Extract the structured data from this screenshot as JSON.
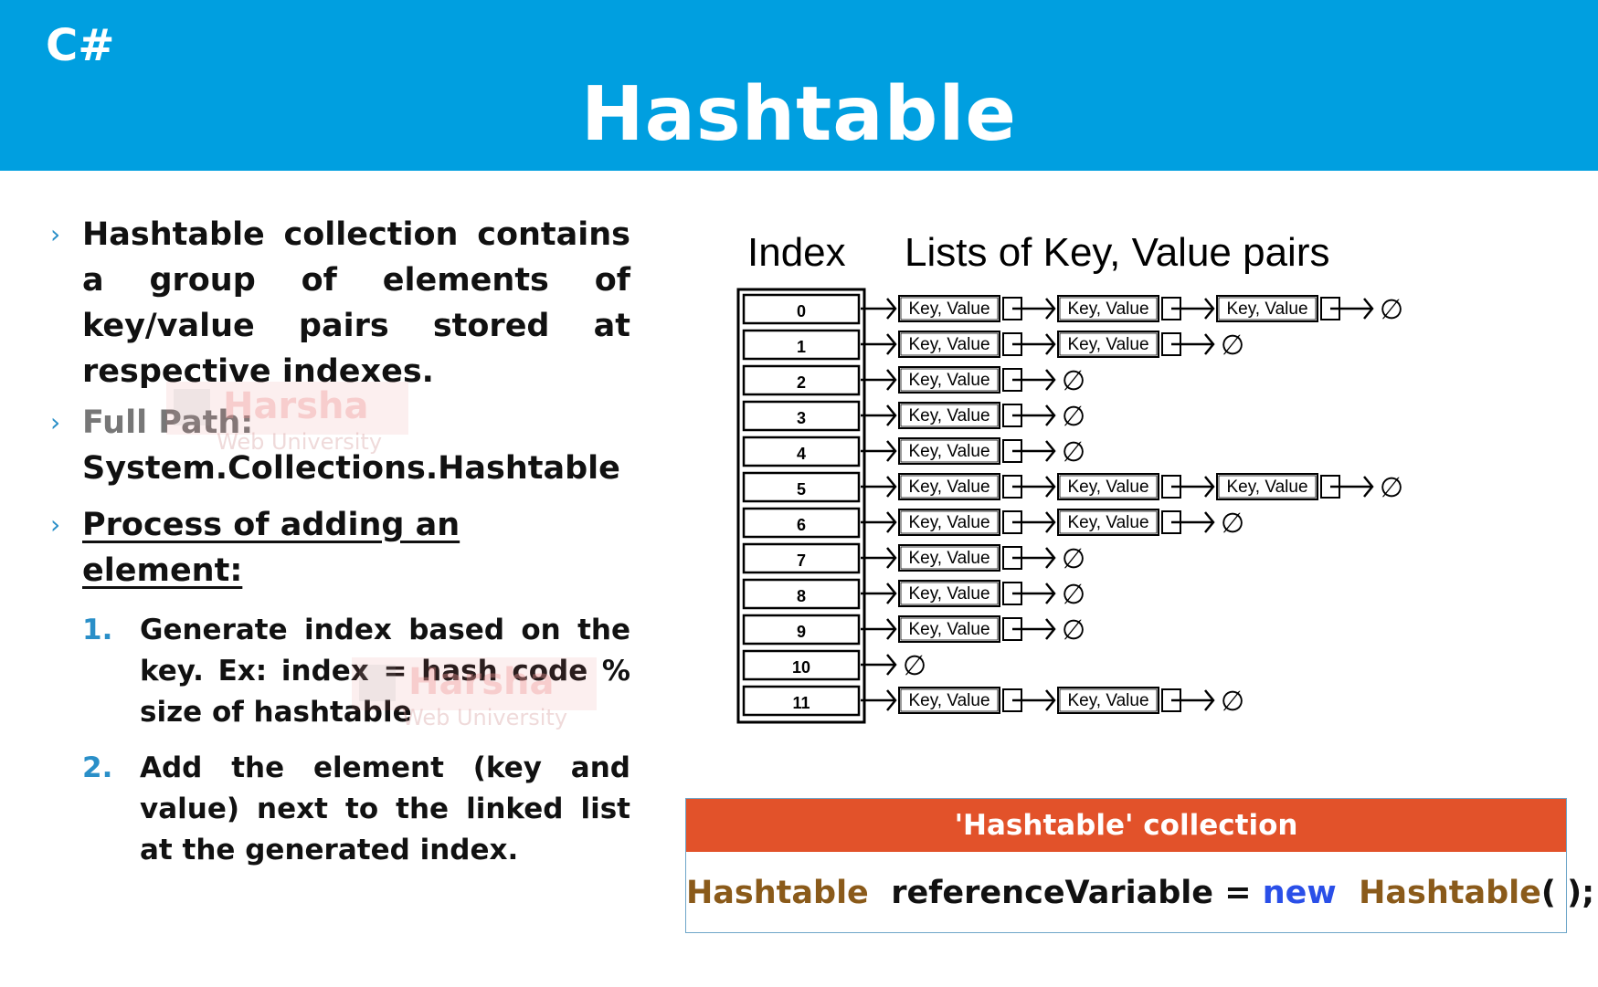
{
  "header": {
    "brand": "C#",
    "title": "Hashtable"
  },
  "content": {
    "bullet1": "Hashtable collection contains a group of elements of key/value pairs stored at respective indexes.",
    "bullet2_label": "Full Path:",
    "bullet2_value": "System.Collections.Hashtable",
    "bullet3_label": "Process of adding an element:",
    "steps": [
      {
        "num": "1.",
        "text": "Generate index based on the key. Ex: index = hash code % size of hashtable"
      },
      {
        "num": "2.",
        "text": "Add the element (key and value) next to the linked list at the generated index."
      }
    ]
  },
  "watermark": {
    "name": "Harsha",
    "sub": "Web University"
  },
  "diagram": {
    "index_heading": "Index",
    "lists_heading": "Lists of Key, Value pairs",
    "entry_label": "Key, Value",
    "null_symbol": "∅",
    "rows": [
      {
        "index": "0",
        "entries": 3
      },
      {
        "index": "1",
        "entries": 2
      },
      {
        "index": "2",
        "entries": 1
      },
      {
        "index": "3",
        "entries": 1
      },
      {
        "index": "4",
        "entries": 1
      },
      {
        "index": "5",
        "entries": 3
      },
      {
        "index": "6",
        "entries": 2
      },
      {
        "index": "7",
        "entries": 1
      },
      {
        "index": "8",
        "entries": 1
      },
      {
        "index": "9",
        "entries": 1
      },
      {
        "index": "10",
        "entries": 0
      },
      {
        "index": "11",
        "entries": 2
      }
    ]
  },
  "code": {
    "heading": "'Hashtable' collection",
    "type_name": "Hashtable",
    "variable": "referenceVariable",
    "equals": "=",
    "keyword": "new",
    "ctor_name": "Hashtable",
    "parens": "( );",
    "colors": {
      "type": "#8a5a1a",
      "keyword": "#2a4fe8",
      "header_bg": "#e2522a"
    }
  },
  "colors": {
    "header_bg": "#009fe0",
    "bullet_accent": "#2a8fc8"
  }
}
